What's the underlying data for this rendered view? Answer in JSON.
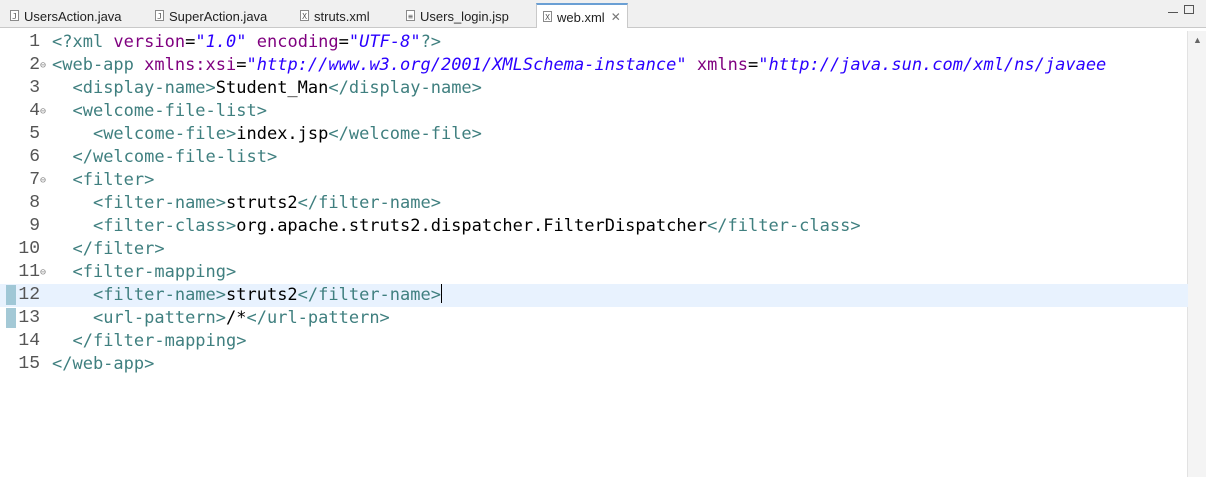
{
  "tabs": [
    {
      "label": "UsersAction.java",
      "icon": "java-file-icon",
      "glyph": "J"
    },
    {
      "label": "SuperAction.java",
      "icon": "java-file-icon",
      "glyph": "J"
    },
    {
      "label": "struts.xml",
      "icon": "xml-file-icon",
      "glyph": "X"
    },
    {
      "label": "Users_login.jsp",
      "icon": "jsp-file-icon",
      "glyph": "≡"
    },
    {
      "label": "web.xml",
      "icon": "xml-file-icon",
      "glyph": "X",
      "active": true,
      "close": "✕"
    }
  ],
  "editor": {
    "current_line": 12,
    "lines": [
      {
        "n": "1",
        "tokens": [
          [
            "pi",
            "<?xml "
          ],
          [
            "attr",
            "version"
          ],
          [
            "txt",
            "="
          ],
          [
            "str",
            "\"1.0\""
          ],
          [
            "txt",
            " "
          ],
          [
            "attr",
            "encoding"
          ],
          [
            "txt",
            "="
          ],
          [
            "str",
            "\"UTF-8\""
          ],
          [
            "pi",
            "?>"
          ]
        ]
      },
      {
        "n": "2",
        "fold": true,
        "tokens": [
          [
            "tag",
            "<web-app "
          ],
          [
            "attr",
            "xmlns:xsi"
          ],
          [
            "txt",
            "="
          ],
          [
            "str",
            "\"http://www.w3.org/2001/XMLSchema-instance\""
          ],
          [
            "txt",
            " "
          ],
          [
            "attr",
            "xmlns"
          ],
          [
            "txt",
            "="
          ],
          [
            "str",
            "\"http://java.sun.com/xml/ns/javaee"
          ]
        ]
      },
      {
        "n": "3",
        "tokens": [
          [
            "txt",
            "  "
          ],
          [
            "tag",
            "<display-name>"
          ],
          [
            "txt",
            "Student_Man"
          ],
          [
            "tag",
            "</display-name>"
          ]
        ]
      },
      {
        "n": "4",
        "fold": true,
        "tokens": [
          [
            "txt",
            "  "
          ],
          [
            "tag",
            "<welcome-file-list>"
          ]
        ]
      },
      {
        "n": "5",
        "tokens": [
          [
            "txt",
            "    "
          ],
          [
            "tag",
            "<welcome-file>"
          ],
          [
            "txt",
            "index.jsp"
          ],
          [
            "tag",
            "</welcome-file>"
          ]
        ]
      },
      {
        "n": "6",
        "tokens": [
          [
            "txt",
            "  "
          ],
          [
            "tag",
            "</welcome-file-list>"
          ]
        ]
      },
      {
        "n": "7",
        "fold": true,
        "tokens": [
          [
            "txt",
            "  "
          ],
          [
            "tag",
            "<filter>"
          ]
        ]
      },
      {
        "n": "8",
        "tokens": [
          [
            "txt",
            "    "
          ],
          [
            "tag",
            "<filter-name>"
          ],
          [
            "txt",
            "struts2"
          ],
          [
            "tag",
            "</filter-name>"
          ]
        ]
      },
      {
        "n": "9",
        "tokens": [
          [
            "txt",
            "    "
          ],
          [
            "tag",
            "<filter-class>"
          ],
          [
            "txt",
            "org.apache.struts2.dispatcher.FilterDispatcher"
          ],
          [
            "tag",
            "</filter-class>"
          ]
        ]
      },
      {
        "n": "10",
        "tokens": [
          [
            "txt",
            "  "
          ],
          [
            "tag",
            "</filter>"
          ]
        ]
      },
      {
        "n": "11",
        "fold": true,
        "tokens": [
          [
            "txt",
            "  "
          ],
          [
            "tag",
            "<filter-mapping>"
          ]
        ]
      },
      {
        "n": "12",
        "tokens": [
          [
            "txt",
            "    "
          ],
          [
            "tag",
            "<filter-name>"
          ],
          [
            "txt",
            "struts2"
          ],
          [
            "tag",
            "</filter-name>"
          ]
        ]
      },
      {
        "n": "13",
        "tokens": [
          [
            "txt",
            "    "
          ],
          [
            "tag",
            "<url-pattern>"
          ],
          [
            "txt",
            "/*"
          ],
          [
            "tag",
            "</url-pattern>"
          ]
        ]
      },
      {
        "n": "14",
        "tokens": [
          [
            "txt",
            "  "
          ],
          [
            "tag",
            "</filter-mapping>"
          ]
        ]
      },
      {
        "n": "15",
        "tokens": [
          [
            "tag",
            "</web-app>"
          ]
        ]
      }
    ]
  },
  "colors": {
    "tag": "#3f7f7f",
    "attribute": "#7f007f",
    "string": "#2a00ff",
    "current_line": "#e8f2fe"
  }
}
